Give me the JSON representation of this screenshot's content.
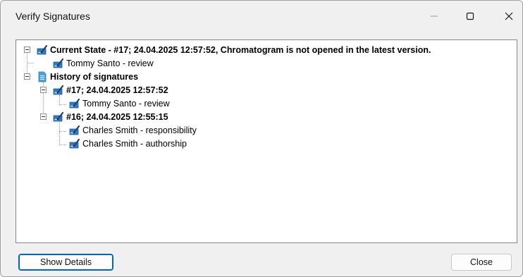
{
  "window": {
    "title": "Verify Signatures"
  },
  "titlebar": {
    "minimize_icon": "minimize-icon",
    "maximize_icon": "maximize-icon",
    "close_icon": "close-icon"
  },
  "tree": {
    "current_state": {
      "label": "Current State - #17;   24.04.2025   12:57:52, Chromatogram is not opened in the latest version.",
      "icon": "signature-icon",
      "children": [
        {
          "label": "Tommy Santo   - review",
          "icon": "signature-icon"
        }
      ]
    },
    "history": {
      "label": "History of signatures",
      "icon": "document-icon",
      "entries": [
        {
          "label": "#17;   24.04.2025   12:57:52",
          "icon": "signature-icon",
          "children": [
            {
              "label": "Tommy Santo   - review",
              "icon": "signature-icon"
            }
          ]
        },
        {
          "label": "#16;   24.04.2025   12:55:15",
          "icon": "signature-icon",
          "children": [
            {
              "label": "Charles Smith   - responsibility",
              "icon": "signature-icon"
            },
            {
              "label": "Charles Smith   - authorship",
              "icon": "signature-icon"
            }
          ]
        }
      ]
    }
  },
  "buttons": {
    "show_details": "Show Details",
    "close": "Close"
  },
  "colors": {
    "accent": "#0067c0",
    "icon_blue": "#2e7bbf",
    "icon_doc": "#4aa3df"
  }
}
